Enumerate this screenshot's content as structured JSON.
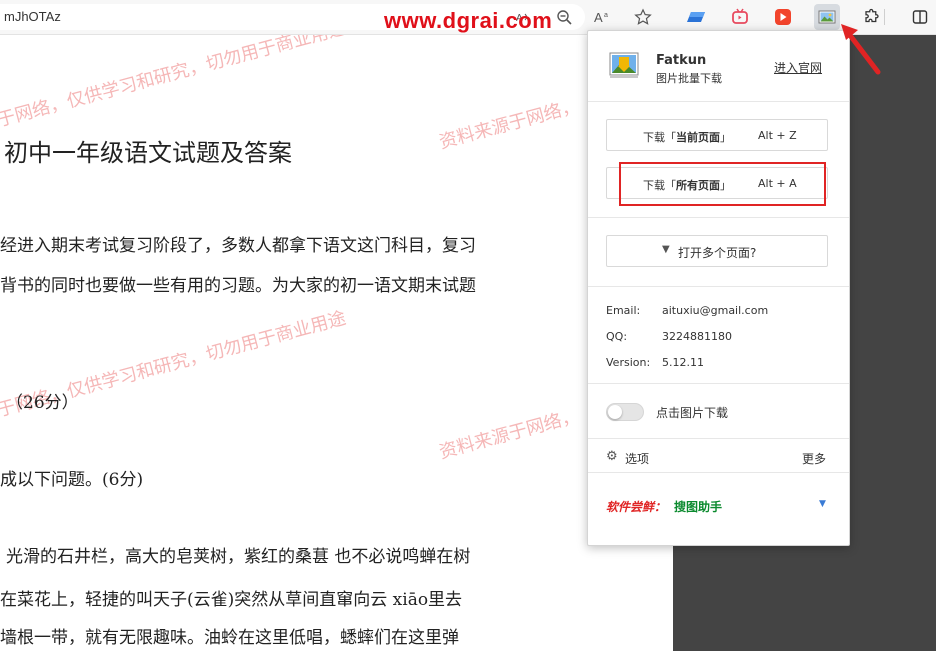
{
  "browser": {
    "address_text": "mJhOTAz",
    "watermark_site": "www.dgrai.com",
    "toolbar_icons": [
      "read-aloud-icon",
      "zoom-out-icon",
      "text-aa-icon",
      "favorite-star-icon",
      "extension-blue-icon",
      "extension-tv-icon",
      "extension-video-icon",
      "fatkun-extension-icon",
      "extensions-puzzle-icon",
      "split-screen-icon"
    ]
  },
  "page": {
    "title": "初中一年级语文试题及答案",
    "paragraphs": [
      "经进入期末考试复习阶段了，多数人都拿下语文这门科目，复习",
      "背书的同时也要做一些有用的习题。为大家的初一语文期末试题",
      "（26分）",
      "成以下问题。(6分)",
      "光滑的石井栏，高大的皂荚树，紫红的桑葚 也不必说鸣蝉在树",
      "在菜花上，轻捷的叫天子(云雀)突然从草间直窜向云  xiāo里去",
      "墙根一带，就有无限趣味。油蛉在这里低唱，蟋蟀们在这里弹"
    ],
    "watermarks": [
      "于网络，仅供学习和研究，切勿用于商业用途",
      "资料来源于网络，",
      "于网络，仅供学习和研究，切勿用于商业用途",
      "资料来源于网络，"
    ]
  },
  "popup": {
    "app_name": "Fatkun",
    "app_subtitle": "图片批量下载",
    "site_link": "进入官网",
    "btn_current": {
      "prefix": "下载「",
      "bold": "当前页面",
      "suffix": "」",
      "shortcut": "Alt + Z"
    },
    "btn_all": {
      "prefix": "下载「",
      "bold": "所有页面",
      "suffix": "」",
      "shortcut": "Alt + A"
    },
    "open_multiple": "打开多个页面?",
    "info": {
      "email_key": "Email:",
      "email_value": "aituxiu@gmail.com",
      "qq_key": "QQ:",
      "qq_value": "3224881180",
      "version_key": "Version:",
      "version_value": "5.12.11"
    },
    "toggle_label": "点击图片下载",
    "toggle_on": false,
    "options_label": "选项",
    "more_label": "更多",
    "promo_label": "软件尝鲜：",
    "promo_app": "搜图助手"
  },
  "colors": {
    "highlight_red": "#e02424",
    "promo_green": "#0b8a2e",
    "watermark_red": "#e86060"
  }
}
